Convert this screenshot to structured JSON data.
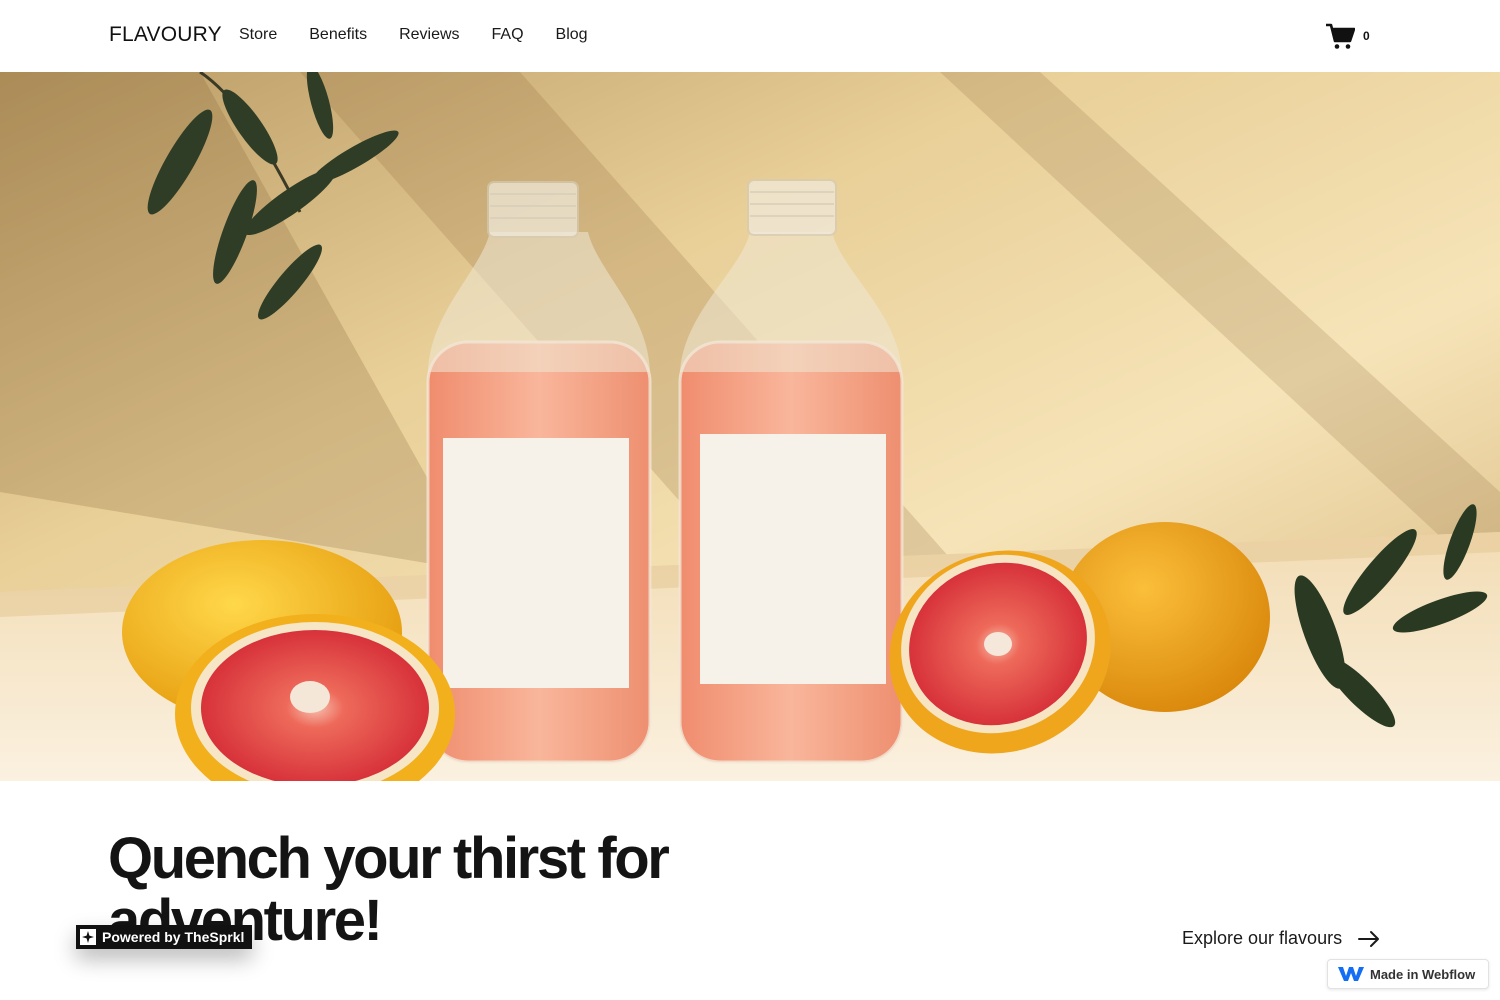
{
  "navbar": {
    "brand": "FLAVOURY",
    "links": [
      {
        "label": "Store"
      },
      {
        "label": "Benefits"
      },
      {
        "label": "Reviews"
      },
      {
        "label": "FAQ"
      },
      {
        "label": "Blog"
      }
    ],
    "cart": {
      "icon": "cart-icon",
      "count": "0"
    }
  },
  "hero": {
    "headline": "Quench your thirst for adventure!",
    "cta_label": "Explore our flavours",
    "cta_icon": "arrow-right-icon"
  },
  "badges": {
    "sprkl": "Powered by TheSprkl",
    "webflow": "Made in Webflow"
  },
  "colors": {
    "background": "#ffffff",
    "text": "#141414",
    "wall": "#f1d9a6",
    "juice": "#f5a184",
    "grapefruit": "#e2453f",
    "lemon": "#f3b51e",
    "leaf": "#2f3d26",
    "webflow_blue": "#146ef5"
  }
}
